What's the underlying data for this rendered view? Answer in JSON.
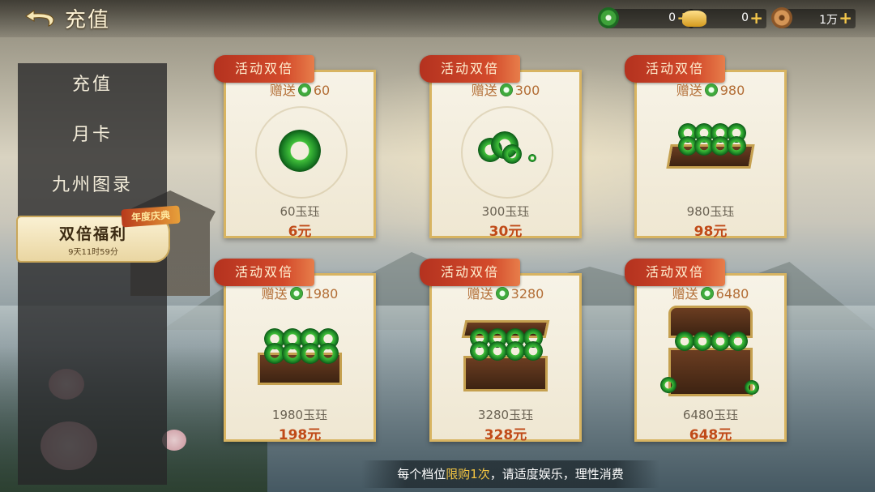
{
  "header": {
    "title": "充值"
  },
  "currencies": [
    {
      "icon": "jade-coin-icon",
      "value": "0",
      "color": "#3fa33a"
    },
    {
      "icon": "gold-ingot-icon",
      "value": "0",
      "color": "#e0a52a"
    },
    {
      "icon": "copper-coin-icon",
      "value": "1万",
      "color": "#b4783a"
    }
  ],
  "sidebar": {
    "items": [
      {
        "label": "充值"
      },
      {
        "label": "月卡"
      },
      {
        "label": "九州图录"
      },
      {
        "label": "双倍福利",
        "timer": "9天11时59分",
        "badge": "年度庆典"
      }
    ]
  },
  "cards": [
    {
      "ribbon": "活动双倍",
      "gift_prefix": "赠送",
      "gift": "60",
      "name": "60玉珏",
      "price": "6元",
      "art": "single-ring"
    },
    {
      "ribbon": "活动双倍",
      "gift_prefix": "赠送",
      "gift": "300",
      "name": "300玉珏",
      "price": "30元",
      "art": "rings"
    },
    {
      "ribbon": "活动双倍",
      "gift_prefix": "赠送",
      "gift": "980",
      "name": "980玉珏",
      "price": "98元",
      "art": "tray"
    },
    {
      "ribbon": "活动双倍",
      "gift_prefix": "赠送",
      "gift": "1980",
      "name": "1980玉珏",
      "price": "198元",
      "art": "box"
    },
    {
      "ribbon": "活动双倍",
      "gift_prefix": "赠送",
      "gift": "3280",
      "name": "3280玉珏",
      "price": "328元",
      "art": "open-box"
    },
    {
      "ribbon": "活动双倍",
      "gift_prefix": "赠送",
      "gift": "6480",
      "name": "6480玉珏",
      "price": "648元",
      "art": "chest"
    }
  ],
  "footer": {
    "pre": "每个档位",
    "highlight": "限购1次",
    "post": "，请适度娱乐，理性消费"
  }
}
